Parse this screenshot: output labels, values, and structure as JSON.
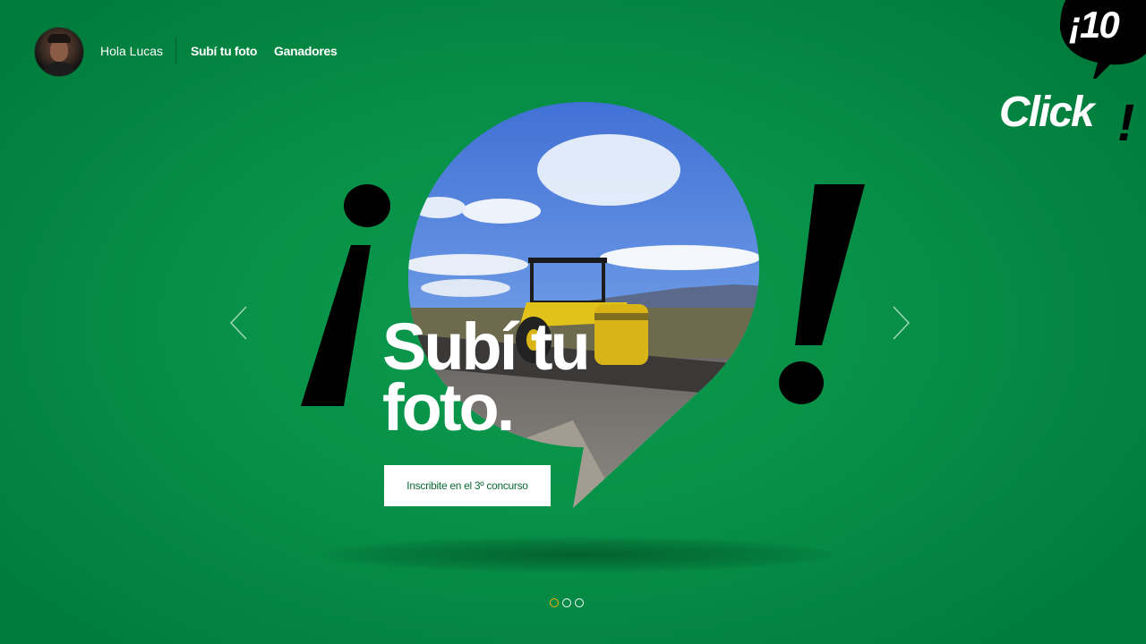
{
  "header": {
    "greeting": "Hola Lucas",
    "nav": [
      {
        "label": "Subí tu foto"
      },
      {
        "label": "Ganadores"
      }
    ]
  },
  "logo": {
    "number": "¡10",
    "word": "Click",
    "exclamation": "!"
  },
  "hero": {
    "title_line1": "Subí tu",
    "title_line2": "foto.",
    "cta_label": "Inscribite en el 3º concurso"
  },
  "carousel": {
    "active_index": 0,
    "total": 3
  },
  "colors": {
    "background": "#089148",
    "brand_black": "#000000",
    "active_dot": "#f6b10b",
    "cta_text": "#0a6a34"
  },
  "icons": [
    "chevron-left-icon",
    "chevron-right-icon",
    "avatar"
  ]
}
